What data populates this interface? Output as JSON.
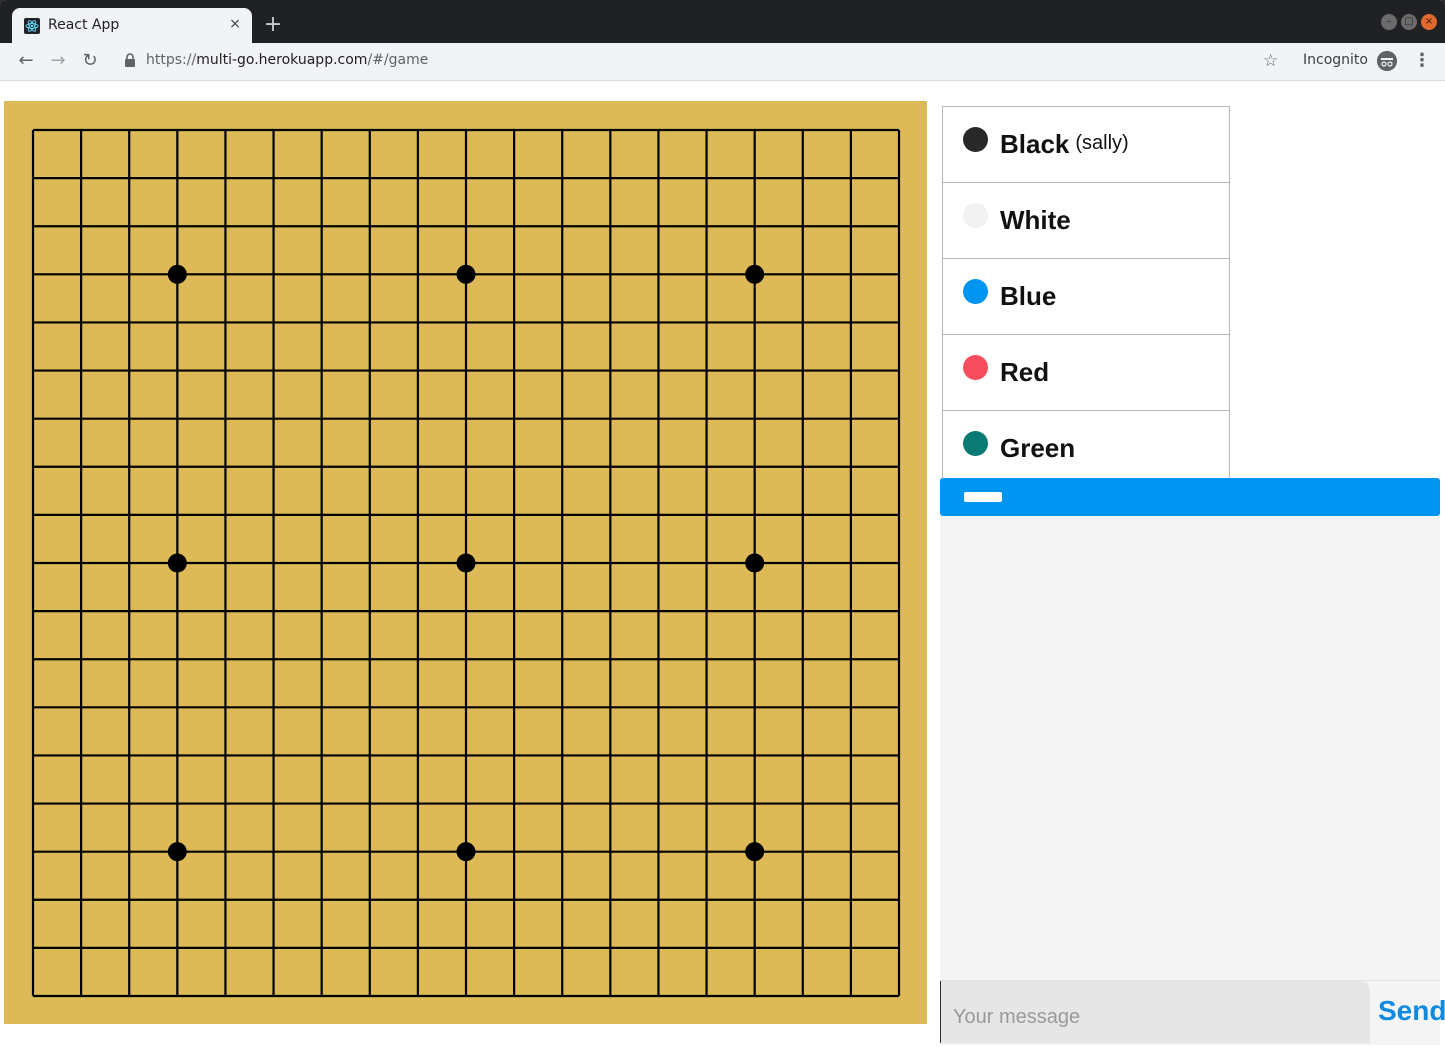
{
  "browser": {
    "tab_title": "React App",
    "tab_close": "×",
    "new_tab": "+",
    "url_scheme": "https://",
    "url_host": "multi-go.herokuapp.com",
    "url_path": "/#/game",
    "incognito_label": "Incognito",
    "back_icon": "arrow-left-icon",
    "forward_icon": "arrow-right-icon",
    "reload_icon": "reload-icon",
    "star_icon": "star-icon",
    "menu_icon": "kebab-menu-icon"
  },
  "board": {
    "size": 19,
    "line_color": "#000000",
    "background": "#deb957",
    "star_points": [
      [
        3,
        3
      ],
      [
        3,
        9
      ],
      [
        3,
        15
      ],
      [
        9,
        3
      ],
      [
        9,
        9
      ],
      [
        9,
        15
      ],
      [
        15,
        3
      ],
      [
        15,
        9
      ],
      [
        15,
        15
      ]
    ]
  },
  "players": [
    {
      "name": "Black",
      "user": "(sally)",
      "color": "#282828"
    },
    {
      "name": "White",
      "user": "",
      "color": "#f2f2f2"
    },
    {
      "name": "Blue",
      "user": "",
      "color": "#0095f1"
    },
    {
      "name": "Red",
      "user": "",
      "color": "#f84c5f"
    },
    {
      "name": "Green",
      "user": "",
      "color": "#097a74"
    }
  ],
  "chat": {
    "header_color": "#0095f1",
    "input_placeholder": "Your message",
    "input_value": "",
    "send_label": "Send"
  }
}
